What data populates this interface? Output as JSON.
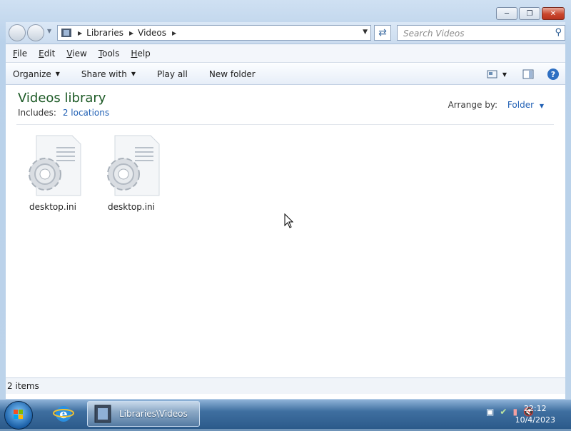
{
  "window": {
    "breadcrumb": [
      "Libraries",
      "Videos"
    ],
    "search_placeholder": "Search Videos"
  },
  "menu": [
    "File",
    "Edit",
    "View",
    "Tools",
    "Help"
  ],
  "toolbar": {
    "organize": "Organize",
    "share_with": "Share with",
    "play_all": "Play all",
    "new_folder": "New folder"
  },
  "library": {
    "title": "Videos library",
    "includes_label": "Includes:",
    "locations_link": "2 locations",
    "arrange_label": "Arrange by:",
    "arrange_value": "Folder"
  },
  "files": [
    {
      "name": "desktop.ini"
    },
    {
      "name": "desktop.ini"
    }
  ],
  "status": {
    "items": "2 items"
  },
  "taskbar": {
    "active_window": "Libraries\\Videos",
    "time": "22:12",
    "date": "10/4/2023"
  },
  "icons": {
    "accent": "#1d5a26",
    "link": "#1f5fb4"
  }
}
